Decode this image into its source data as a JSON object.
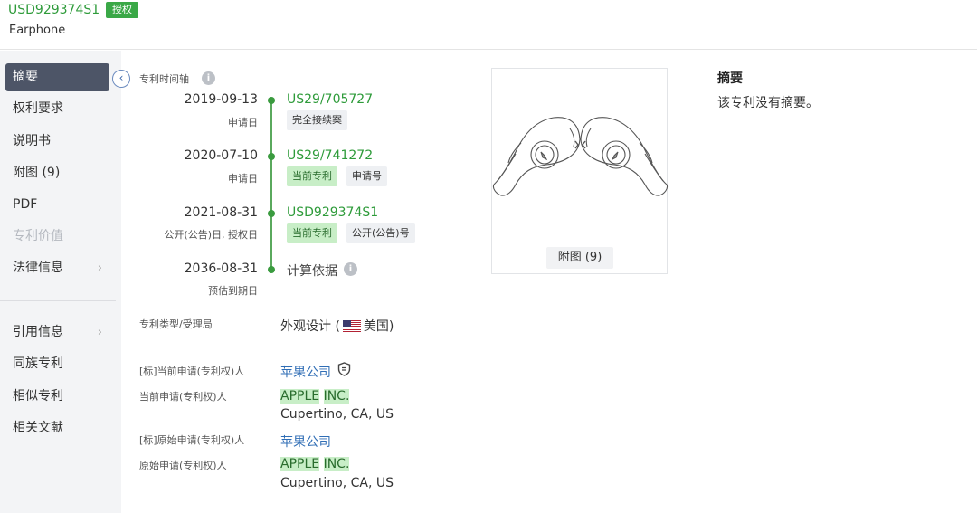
{
  "header": {
    "patent_id": "USD929374S1",
    "status": "授权",
    "title": "Earphone"
  },
  "sidebar": {
    "items": [
      {
        "label": "摘要"
      },
      {
        "label": "权利要求"
      },
      {
        "label": "说明书"
      },
      {
        "label": "附图 (9)"
      },
      {
        "label": "PDF"
      },
      {
        "label": "专利价值"
      },
      {
        "label": "法律信息"
      },
      {
        "label": "引用信息"
      },
      {
        "label": "同族专利"
      },
      {
        "label": "相似专利"
      },
      {
        "label": "相关文献"
      }
    ],
    "chevron": "›"
  },
  "timeline": {
    "heading": "专利时间轴",
    "events": [
      {
        "date": "2019-09-13",
        "sub": "申请日",
        "number": "US29/705727",
        "tags": [
          "完全接续案"
        ]
      },
      {
        "date": "2020-07-10",
        "sub": "申请日",
        "number": "US29/741272",
        "tags": [
          "当前专利",
          "申请号"
        ]
      },
      {
        "date": "2021-08-31",
        "sub": "公开(公告)日, 授权日",
        "number": "USD929374S1",
        "tags": [
          "当前专利",
          "公开(公告)号"
        ]
      },
      {
        "date": "2036-08-31",
        "sub": "预估到期日",
        "number": "计算依据",
        "tags": []
      }
    ]
  },
  "details": {
    "type_label": "专利类型/受理局",
    "type_value": "外观设计 (",
    "country": "美国)",
    "std_current_label": "[标]当前申请(专利权)人",
    "std_current_value": "苹果公司",
    "current_label": "当前申请(专利权)人",
    "current_name_1": "APPLE",
    "current_name_2": "INC.",
    "current_addr": "Cupertino, CA, US",
    "std_original_label": "[标]原始申请(专利权)人",
    "std_original_value": "苹果公司",
    "original_label": "原始申请(专利权)人",
    "original_name_1": "APPLE",
    "original_name_2": "INC.",
    "original_addr": "Cupertino, CA, US"
  },
  "figures": {
    "button": "附图 (9)"
  },
  "abstract": {
    "title": "摘要",
    "text": "该专利没有摘要。"
  },
  "icons": {
    "info": "i",
    "collapse": "‹"
  },
  "colors": {
    "accent_green": "#2e9b3a",
    "link_blue": "#2f6db5",
    "sidebar_active": "#4d5567"
  }
}
